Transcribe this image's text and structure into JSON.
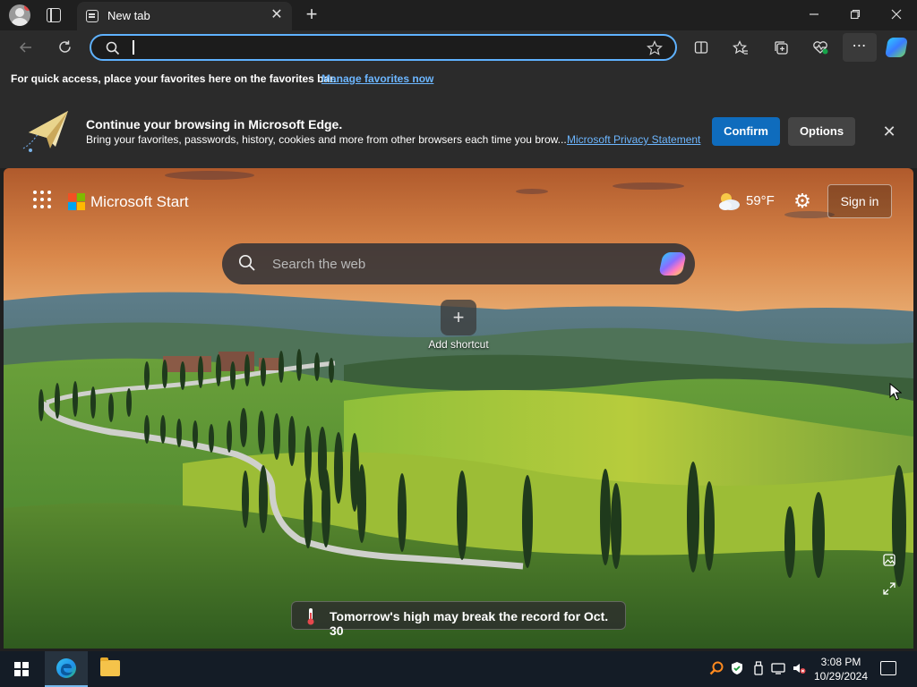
{
  "browser": {
    "tab_title": "New tab",
    "tab_close": "✕",
    "new_tab": "+",
    "window_controls": {
      "minimize": "—",
      "restore": "❐",
      "close": "✕"
    }
  },
  "address_bar": {
    "value": "",
    "placeholder": ""
  },
  "toolbar": {
    "more": "⋯"
  },
  "favorites_bar": {
    "text": "For quick access, place your favorites here on the favorites bar.",
    "link": "Manage favorites now"
  },
  "notification": {
    "title": "Continue your browsing in Microsoft Edge.",
    "body": "Bring your favorites, passwords, history, cookies and more from other browsers each time you brow...",
    "link": "Microsoft Privacy Statement",
    "confirm": "Confirm",
    "options": "Options",
    "close": "✕"
  },
  "start_page": {
    "brand": "Microsoft Start",
    "temperature": "59°F",
    "sign_in": "Sign in",
    "search_placeholder": "Search the web",
    "add_shortcut_label": "Add shortcut",
    "add_shortcut_symbol": "+",
    "news": "Tomorrow's high may break the record for Oct. 30"
  },
  "taskbar": {
    "time": "3:08 PM",
    "date": "10/29/2024"
  },
  "colors": {
    "accent": "#0f6cbd",
    "link": "#6cb6ff",
    "address_border": "#5fb2ff",
    "taskbar": "#141c26"
  },
  "icons": [
    "profile-icon",
    "tabs-icon",
    "back-icon",
    "refresh-icon",
    "search-icon",
    "favorite-star-icon",
    "split-screen-icon",
    "favorites-icon",
    "collections-icon",
    "browser-essentials-icon",
    "copilot-icon",
    "apps-grid-icon",
    "microsoft-logo-icon",
    "weather-icon",
    "settings-icon",
    "thermometer-icon",
    "windows-start-icon",
    "edge-icon",
    "file-explorer-icon"
  ]
}
